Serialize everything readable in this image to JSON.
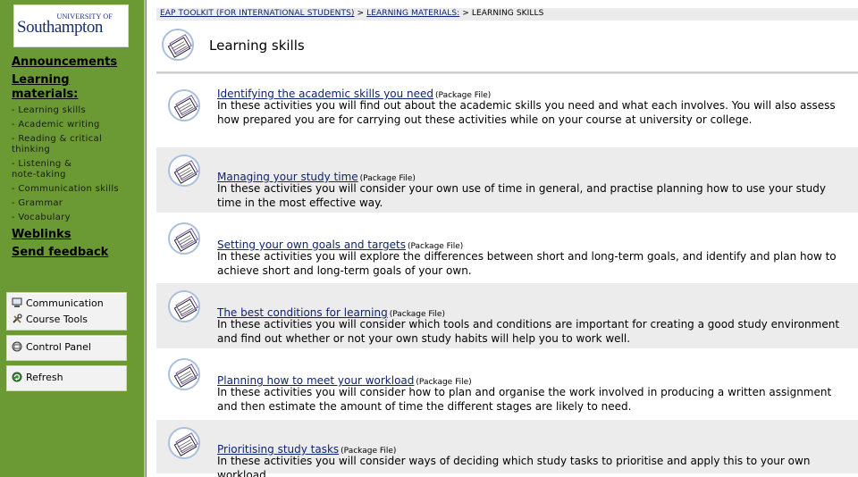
{
  "logo": {
    "university_of": "UNIVERSITY OF",
    "southampton": "Southampton"
  },
  "sidebar": {
    "announcements": "Announcements",
    "learning_materials_line1": "Learning",
    "learning_materials_line2": "materials:",
    "sub_items": [
      "- Learning skills",
      "- Academic writing",
      "- Reading & critical",
      "thinking",
      "- Listening &",
      "note-taking",
      "- Communication skills",
      "- Grammar",
      "- Vocabulary"
    ],
    "weblinks": "Weblinks",
    "send_feedback": "Send feedback"
  },
  "tools": {
    "communication": "Communication",
    "course_tools": "Course Tools",
    "control_panel": "Control Panel",
    "refresh": "Refresh"
  },
  "breadcrumb": {
    "crumb1": "EAP TOOLKIT (FOR INTERNATIONAL STUDENTS)",
    "sep": " > ",
    "crumb2": "LEARNING MATERIALS:",
    "current": "LEARNING SKILLS"
  },
  "page_title": "Learning skills",
  "items": [
    {
      "title": "Identifying the academic skills you need",
      "tag": "(Package File)",
      "desc": "In these activities you will find out about the academic skills you need and what each involves. You will also assess how prepared you are for carrying out these activities while on your course at university or college."
    },
    {
      "title": "Managing your study time",
      "tag": "(Package File)",
      "desc": "In these activities you will consider your own use of time in general, and practise planning how to use your study time in the most effective way."
    },
    {
      "title": "Setting your own goals and targets",
      "tag": "(Package File)",
      "desc": "In these activities you will explore the differences between short and long-term goals, and identify and plan how to achieve short and long-term goals of your own."
    },
    {
      "title": "The best conditions for learning",
      "tag": "(Package File)",
      "desc": "In these activities you will consider which tools and conditions are important for creating a good study environment and find out whether or not your own study habits will help you to work well."
    },
    {
      "title": "Planning how to meet your workload",
      "tag": "(Package File)",
      "desc": "In these activities you will consider how to plan and organise the work involved in producing a written assignment and then estimate the amount of time the different stages are likely to need."
    },
    {
      "title": "Prioritising study tasks",
      "tag": "(Package File)",
      "desc": "In these activities you will consider ways of deciding which study tasks to prioritise and apply this to your own workload."
    }
  ],
  "colors": {
    "sidebar": "#6b9a34",
    "link": "#10236e",
    "row_alt": "#ececec"
  }
}
